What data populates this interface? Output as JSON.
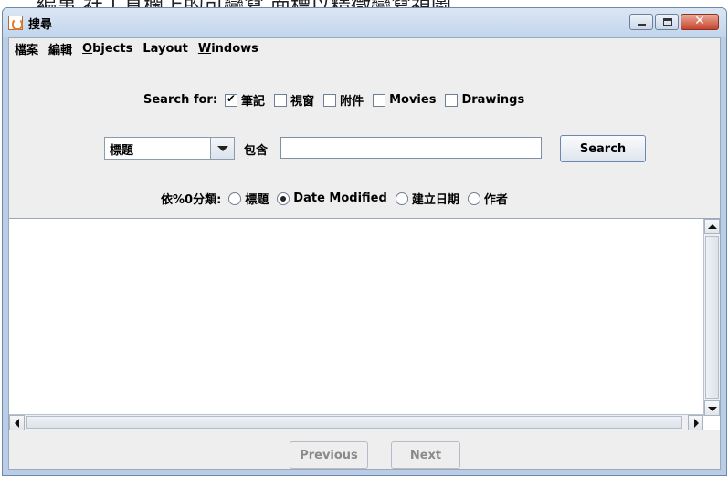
{
  "background": {
    "caption_fragment": "編事 社工具欄上的可變寫          面標以精微變寫視圖"
  },
  "window": {
    "title": "搜尋",
    "buttons": {
      "minimize": "minimize-icon",
      "maximize": "maximize-icon",
      "close": "close-icon"
    }
  },
  "menu": {
    "items": [
      {
        "label": "檔案"
      },
      {
        "label": "編輯"
      },
      {
        "label": "Objects"
      },
      {
        "label": "Layout"
      },
      {
        "label": "Windows"
      }
    ]
  },
  "search_for": {
    "label": "Search for:",
    "options": [
      {
        "label": "筆記",
        "checked": true
      },
      {
        "label": "視窗",
        "checked": false
      },
      {
        "label": "附件",
        "checked": false
      },
      {
        "label": "Movies",
        "checked": false
      },
      {
        "label": "Drawings",
        "checked": false
      }
    ]
  },
  "query": {
    "field_selected": "標題",
    "contains_label": "包含",
    "input_value": "",
    "search_button": "Search"
  },
  "sort": {
    "label": "依%0分類:",
    "options": [
      {
        "label": "標題",
        "selected": false
      },
      {
        "label": "Date Modified",
        "selected": true
      },
      {
        "label": "建立日期",
        "selected": false
      },
      {
        "label": "作者",
        "selected": false
      }
    ]
  },
  "results": {
    "items": []
  },
  "pager": {
    "previous": "Previous",
    "next": "Next",
    "enabled": false
  }
}
